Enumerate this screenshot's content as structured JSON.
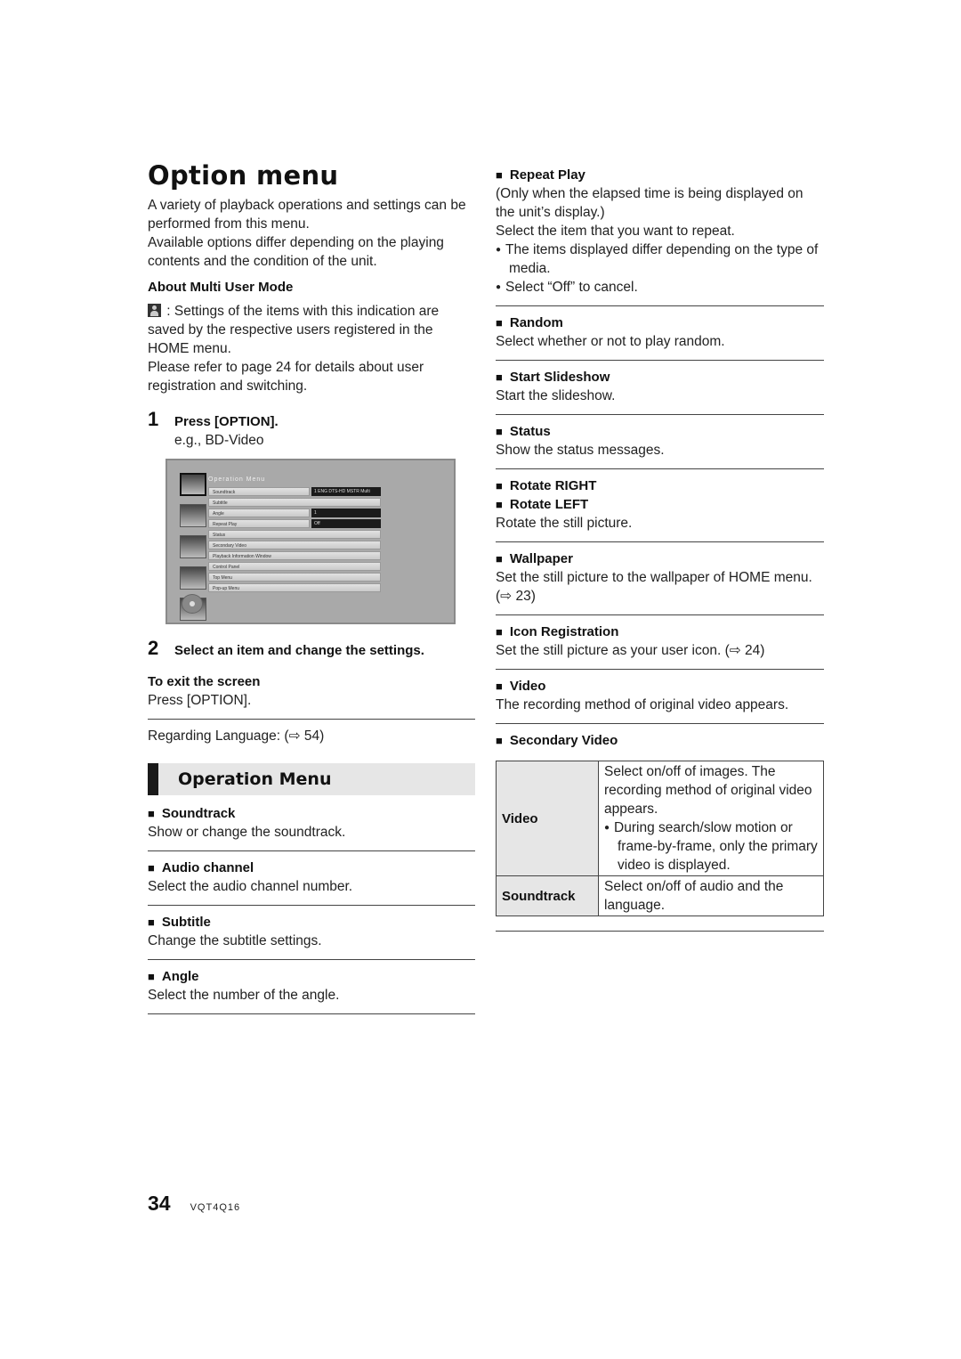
{
  "page": {
    "title": "Option menu",
    "intro": [
      "A variety of playback operations and settings can be performed from this menu.",
      "Available options differ depending on the playing contents and the condition of the unit."
    ],
    "multi_user": {
      "heading": "About Multi User Mode",
      "icon": "user-icon",
      "text": " : Settings of the items with this indication are saved by the respective users registered in the HOME menu.",
      "refer": "Please refer to page 24 for details about user registration and switching."
    },
    "steps": [
      {
        "num": "1",
        "text": "Press [OPTION].",
        "sub": "e.g., BD-Video"
      },
      {
        "num": "2",
        "text": "Select an item and change the settings."
      }
    ],
    "screen": {
      "title": "Operation Menu",
      "rows": [
        {
          "label": "Soundtrack",
          "value": "1 ENG DTS-HD MSTR Multi"
        },
        {
          "label": "Subtitle",
          "value": null
        },
        {
          "label": "Angle",
          "value": "1"
        },
        {
          "label": "Repeat Play",
          "value": "Off"
        },
        {
          "label": "Status",
          "value": null
        },
        {
          "label": "Secondary Video",
          "value": null
        },
        {
          "label": "Playback Information Window",
          "value": null
        },
        {
          "label": "Control Panel",
          "value": null
        },
        {
          "label": "Top Menu",
          "value": null
        },
        {
          "label": "Pop-up Menu",
          "value": null
        }
      ]
    },
    "exit": {
      "heading": "To exit the screen",
      "text": "Press [OPTION]."
    },
    "language_ref": "Regarding Language: (⇨ 54)",
    "section": "Operation Menu",
    "left_items": [
      {
        "heading": "Soundtrack",
        "text": "Show or change the soundtrack."
      },
      {
        "heading": "Audio channel",
        "text": "Select the audio channel number."
      },
      {
        "heading": "Subtitle",
        "text": "Change the subtitle settings."
      },
      {
        "heading": "Angle",
        "text": "Select the number of the angle."
      }
    ],
    "repeat_play": {
      "heading": "Repeat Play",
      "lines": [
        "(Only when the elapsed time is being displayed on the unit’s display.)",
        "Select the item that you want to repeat."
      ],
      "bullets": [
        "The items displayed differ depending on the type of media.",
        "Select “Off” to cancel."
      ]
    },
    "right_items": [
      {
        "headings": [
          "Random"
        ],
        "text": "Select whether or not to play random."
      },
      {
        "headings": [
          "Start Slideshow"
        ],
        "text": "Start the slideshow."
      },
      {
        "headings": [
          "Status"
        ],
        "text": "Show the status messages."
      },
      {
        "headings": [
          "Rotate RIGHT",
          "Rotate LEFT"
        ],
        "text": "Rotate the still picture."
      },
      {
        "headings": [
          "Wallpaper"
        ],
        "text": "Set the still picture to the wallpaper of HOME menu. (⇨ 23)"
      },
      {
        "headings": [
          "Icon Registration"
        ],
        "text": "Set the still picture as your user icon. (⇨ 24)"
      },
      {
        "headings": [
          "Video"
        ],
        "text": "The recording method of original video appears."
      }
    ],
    "secondary_video": {
      "heading": "Secondary Video",
      "rows": [
        {
          "key": "Video",
          "text": "Select on/off of images. The recording method of original video appears.",
          "bullet": "During search/slow motion or frame-by-frame, only the primary video is displayed."
        },
        {
          "key": "Soundtrack",
          "text": "Select on/off of audio and the language."
        }
      ]
    },
    "footer": {
      "page_number": "34",
      "code": "VQT4Q16"
    }
  }
}
